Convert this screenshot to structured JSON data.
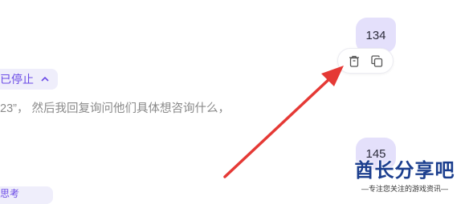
{
  "messages": {
    "user_message_1": "134",
    "user_message_2": "145"
  },
  "status_chip": {
    "label": "已停止"
  },
  "reply": {
    "text": "23”， 然后我回复询问他们具体想咨询什么，"
  },
  "bottom_chip": {
    "label": "思考"
  },
  "watermark": {
    "title": "酋长分享吧",
    "subtitle": "—专注您关注的游戏资讯—"
  },
  "icons": {
    "delete": "trash-icon",
    "copy": "copy-icon",
    "collapse": "chevron-up-icon"
  },
  "colors": {
    "bubble": "#e4e0fb",
    "accent": "#6b4be6",
    "arrow": "#e53935"
  }
}
